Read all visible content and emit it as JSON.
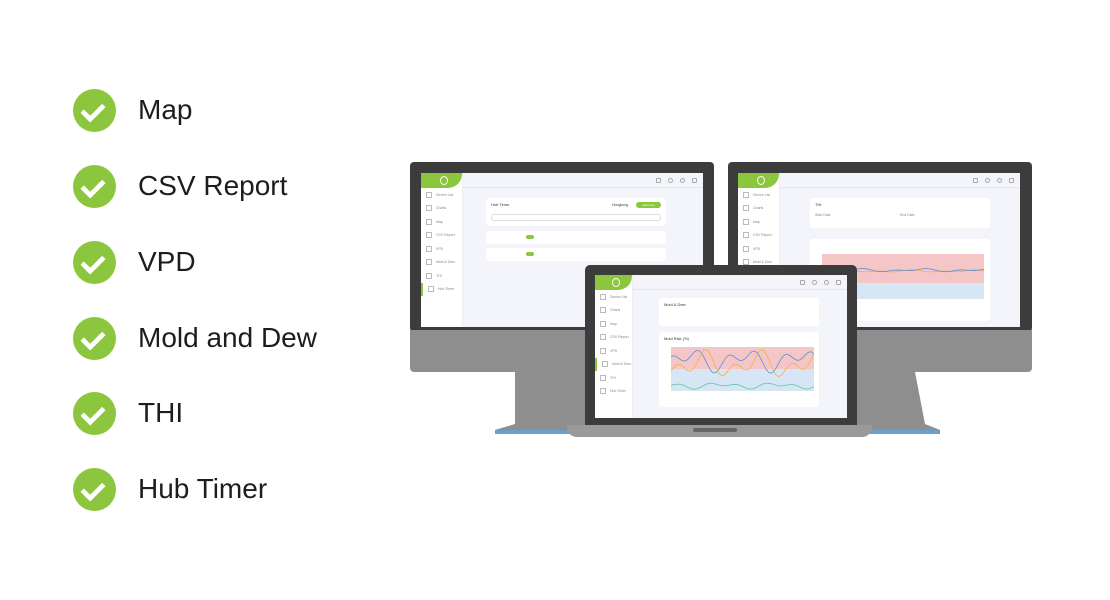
{
  "features": [
    "Map",
    "CSV Report",
    "VPD",
    "Mold and Dew",
    "THI",
    "Hub Timer"
  ],
  "colors": {
    "accent": "#8cc63f",
    "bezel": "#3c3c3c",
    "chin": "#8e8e8e",
    "risk_high": "#f5c6c8",
    "risk_low": "#d6e6f5"
  },
  "sidebar": [
    "Device List",
    "Charts",
    "Map",
    "CSV Report",
    "VPD",
    "Mold & Dew",
    "THI",
    "Hub Timer"
  ],
  "screens": {
    "left": {
      "title": "Hub Timer",
      "location": "Hongkong",
      "add_button": "Add timer",
      "active": 7
    },
    "right": {
      "title": "THI",
      "start_label": "Start Date",
      "end_label": "End Date",
      "active": 6
    },
    "laptop": {
      "title": "Mold & Dew",
      "chart_title": "Mold Risk (%)",
      "active": 5
    }
  },
  "icons": [
    "check-circle-icon",
    "logo-icon",
    "device-list-icon",
    "charts-icon",
    "map-icon",
    "csv-report-icon",
    "vpd-icon",
    "mold-dew-icon",
    "thi-icon",
    "hub-timer-icon",
    "battery-icon",
    "settings-icon",
    "user-icon",
    "logout-icon"
  ]
}
